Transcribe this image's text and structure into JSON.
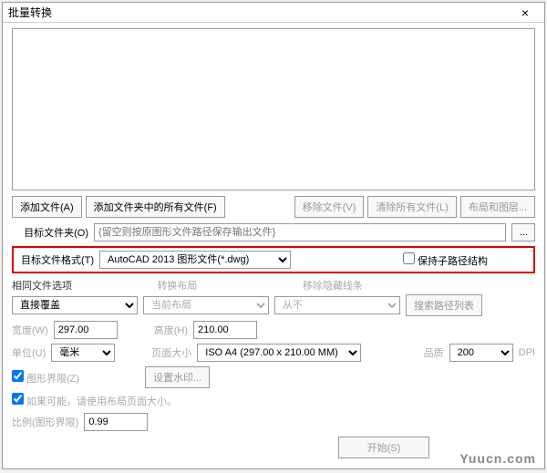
{
  "title": "批量转换",
  "buttons": {
    "add_file": "添加文件(A)",
    "add_folder": "添加文件夹中的所有文件(F)",
    "remove_file": "移除文件(V)",
    "clear_all": "清除所有文件(L)",
    "layout_layer": "布局和图层...",
    "browse": "...",
    "set_watermark": "设置水印...",
    "start": "开始(S)"
  },
  "labels": {
    "target_folder": "目标文件夹(O)",
    "target_format": "目标文件格式(T)",
    "keep_path": "保持子路径结构",
    "same_file_opt": "相同文件选项",
    "convert_layout": "转换布局",
    "remove_hidden": "移除隐藏线条",
    "search_paths": "搜索路径列表",
    "width": "宽度(W)",
    "height": "高度(H)",
    "unit": "单位(U)",
    "page_size": "页面大小",
    "quality": "品质",
    "dpi": "DPI",
    "drawing_limit": "图形界限(Z)",
    "use_layout_size": "如果可能，请使用布局页面大小。",
    "scale": "比例(图形界限)"
  },
  "values": {
    "target_folder_ph": "{留空则按原图形文件路径保存输出文件}",
    "target_format": "AutoCAD 2013 图形文件(*.dwg)",
    "same_file_opt": "直接覆盖",
    "convert_layout": "当前布局",
    "remove_hidden": "从不",
    "width": "297.00",
    "height": "210.00",
    "unit": "毫米",
    "page_size": "ISO A4 (297.00 x 210.00 MM)",
    "quality": "200",
    "scale": "0.99"
  },
  "watermark": "Yuucn.com"
}
